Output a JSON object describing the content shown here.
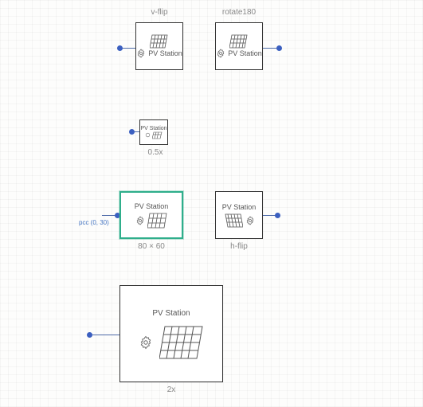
{
  "blocks": {
    "vflip": {
      "title": "PV Station",
      "caption": "v-flip"
    },
    "rotate180": {
      "title": "PV Station",
      "caption": "rotate180"
    },
    "halfx": {
      "title": "PV Station",
      "caption": "0.5x"
    },
    "selected": {
      "title": "PV Station",
      "caption": "80 × 60",
      "annotation": "pcc (0, 30)"
    },
    "hflip": {
      "title": "PV Station",
      "caption": "h-flip"
    },
    "twox": {
      "title": "PV Station",
      "caption": "2x"
    }
  }
}
